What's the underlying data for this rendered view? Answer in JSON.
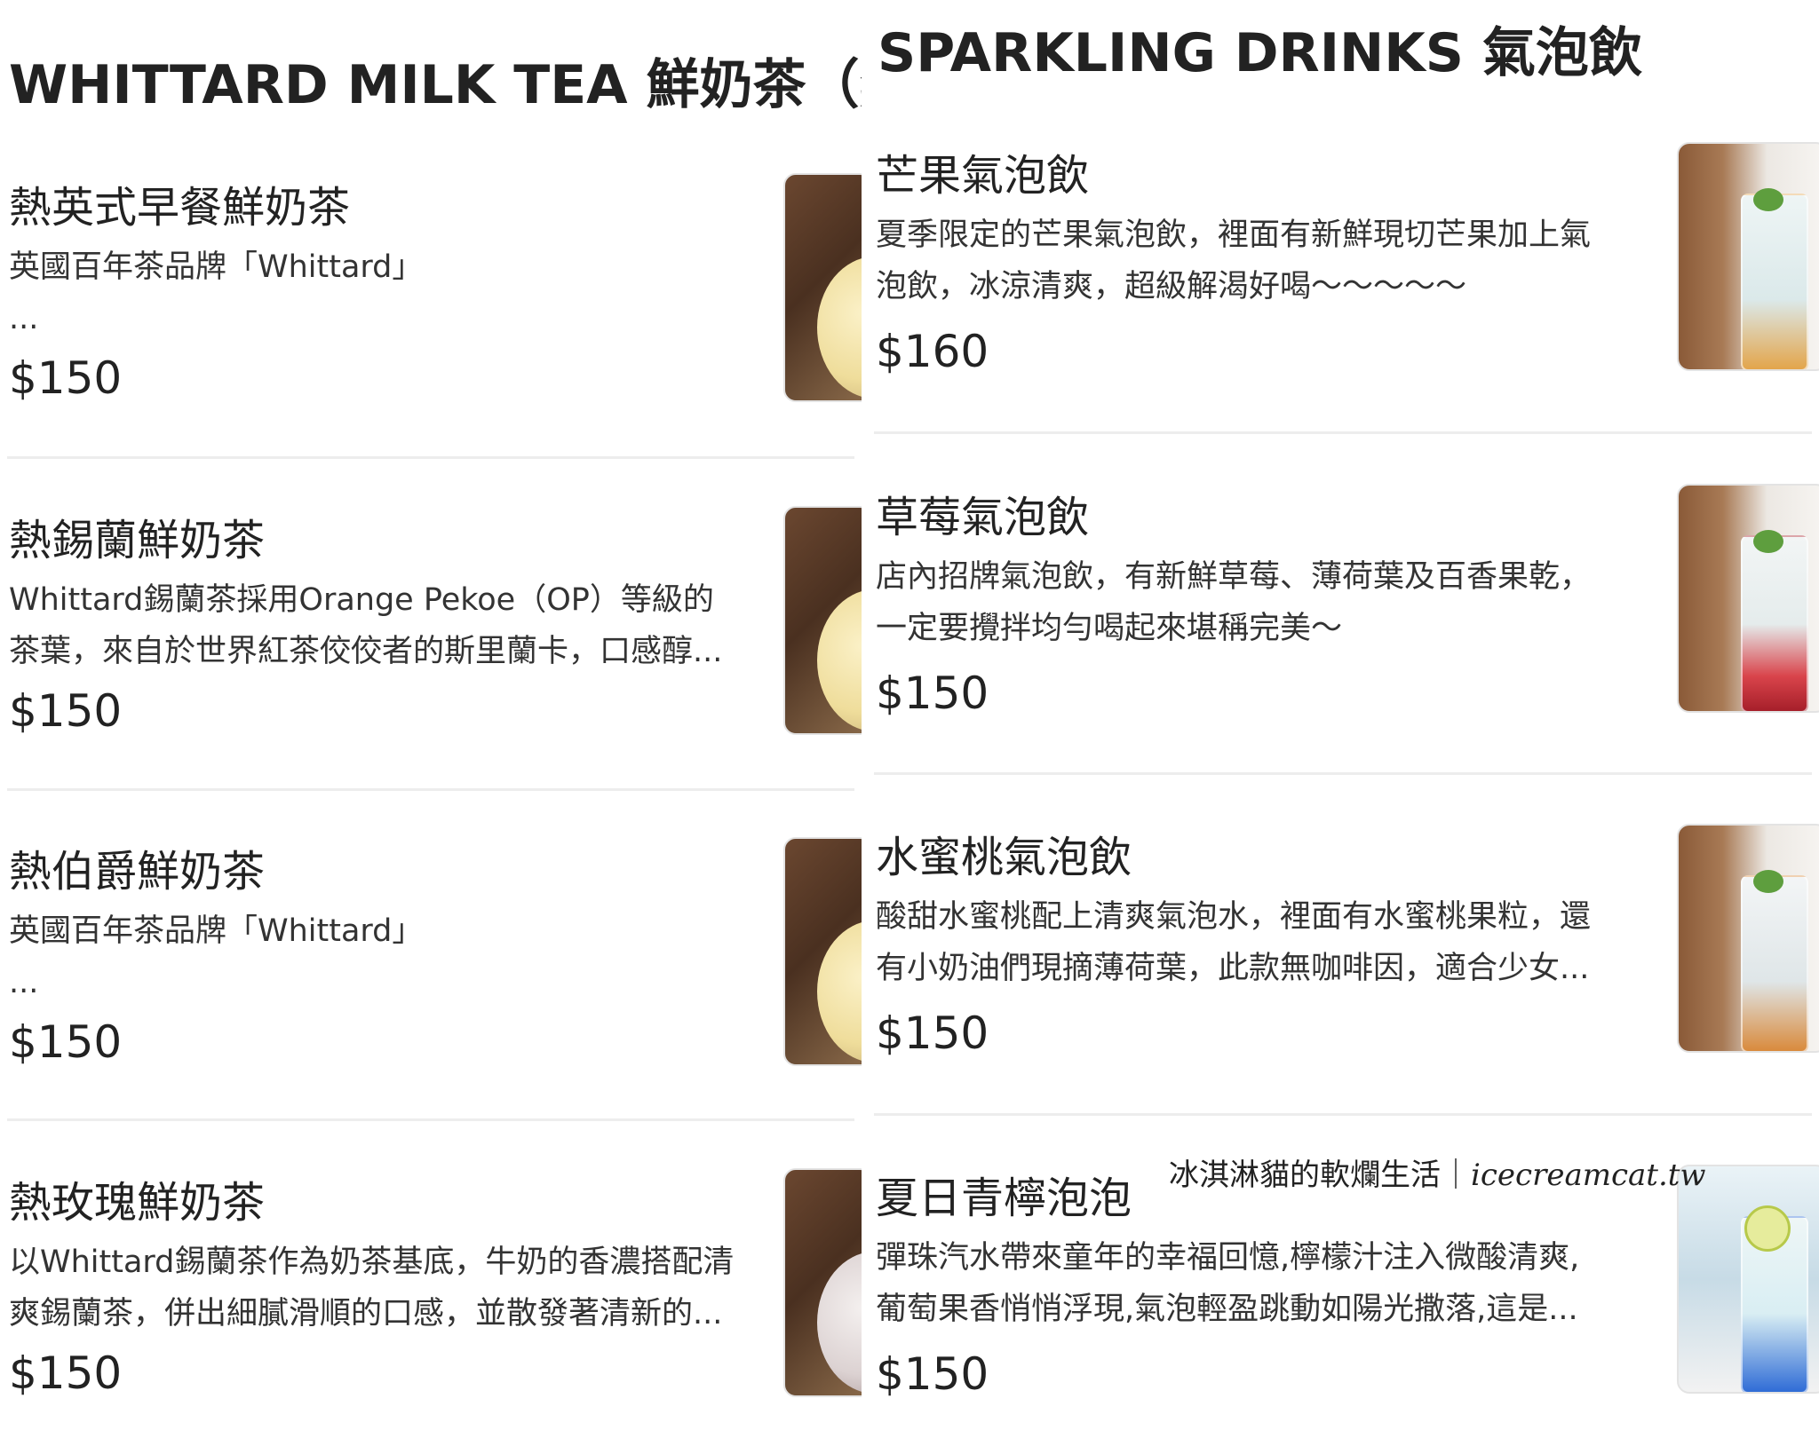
{
  "left": {
    "title": "WHITTARD MILK TEA 鮮奶茶（熱飲）",
    "items": [
      {
        "name": "熱英式早餐鮮奶茶",
        "desc_lines": [
          "英國百年茶品牌「Whittard」",
          "..."
        ],
        "price": "$150",
        "image": "milk-tea-cup-thumbnail"
      },
      {
        "name": "熱錫蘭鮮奶茶",
        "desc_lines": [
          "Whittard錫蘭茶採用Orange Pekoe（OP）等級的",
          "茶葉，來自於世界紅茶佼佼者的斯里蘭卡，口感醇..."
        ],
        "price": "$150",
        "image": "milk-tea-cup-thumbnail"
      },
      {
        "name": "熱伯爵鮮奶茶",
        "desc_lines": [
          "英國百年茶品牌「Whittard」",
          "..."
        ],
        "price": "$150",
        "image": "milk-tea-cup-thumbnail"
      },
      {
        "name": "熱玫瑰鮮奶茶",
        "desc_lines": [
          "以Whittard錫蘭茶作為奶茶基底，牛奶的香濃搭配清",
          "爽錫蘭茶，併出細膩滑順的口感，並散發著清新的..."
        ],
        "price": "$150",
        "image": "rose-milk-tea-thumbnail"
      }
    ]
  },
  "right": {
    "title": "SPARKLING DRINKS 氣泡飲",
    "items": [
      {
        "name": "芒果氣泡飲",
        "desc_lines": [
          "夏季限定的芒果氣泡飲，裡面有新鮮現切芒果加上氣",
          "泡飲，冰涼清爽，超級解渴好喝～～～～～"
        ],
        "price": "$160",
        "image": "mango-sparkling-thumbnail"
      },
      {
        "name": "草莓氣泡飲",
        "desc_lines": [
          "店內招牌氣泡飲，有新鮮草莓、薄荷葉及百香果乾，",
          "一定要攪拌均勻喝起來堪稱完美～"
        ],
        "price": "$150",
        "image": "strawberry-sparkling-thumbnail"
      },
      {
        "name": "水蜜桃氣泡飲",
        "desc_lines": [
          "酸甜水蜜桃配上清爽氣泡水，裡面有水蜜桃果粒，還",
          "有小奶油們現摘薄荷葉，此款無咖啡因，適合少女..."
        ],
        "price": "$150",
        "image": "peach-sparkling-thumbnail"
      },
      {
        "name": "夏日青檸泡泡",
        "desc_lines": [
          "彈珠汽水帶來童年的幸福回憶,檸檬汁注入微酸清爽,",
          "葡萄果香悄悄浮現,氣泡輕盈跳動如陽光撒落,這是..."
        ],
        "price": "$150",
        "image": "lime-sparkling-thumbnail"
      }
    ]
  },
  "watermark": {
    "text": "冰淇淋貓的軟爛生活｜",
    "url": "icecreamcat.tw"
  }
}
